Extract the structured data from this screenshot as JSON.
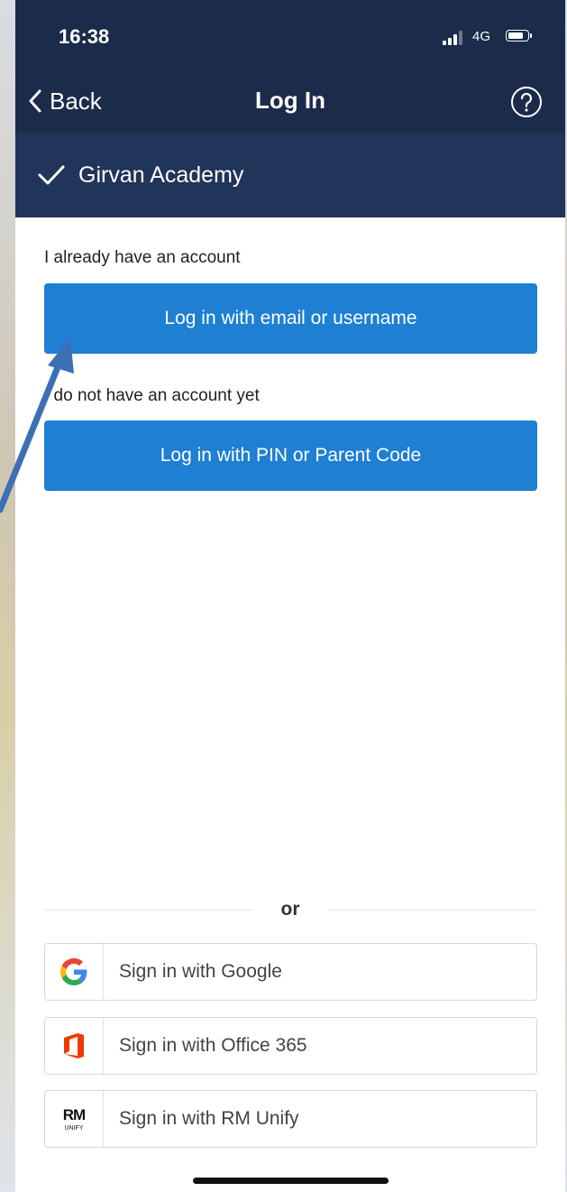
{
  "status": {
    "time": "16:38",
    "network": "4G"
  },
  "nav": {
    "back_label": "Back",
    "title": "Log In"
  },
  "school": {
    "name": "Girvan Academy"
  },
  "account": {
    "existing_label": "I already have an account",
    "email_button": "Log in with email or username",
    "new_label": "I do not have an account yet",
    "pin_button": "Log in with PIN or Parent Code"
  },
  "alt": {
    "or_label": "or",
    "google": "Sign in with Google",
    "office": "Sign in with Office 365",
    "rm": "Sign in with RM Unify",
    "rm_logo_top": "RM",
    "rm_logo_bottom": "UNIFY"
  },
  "colors": {
    "header": "#1c2b4a",
    "school_bar": "#21345a",
    "primary": "#1e7fd3",
    "annotation_arrow": "#3d6fb6"
  }
}
